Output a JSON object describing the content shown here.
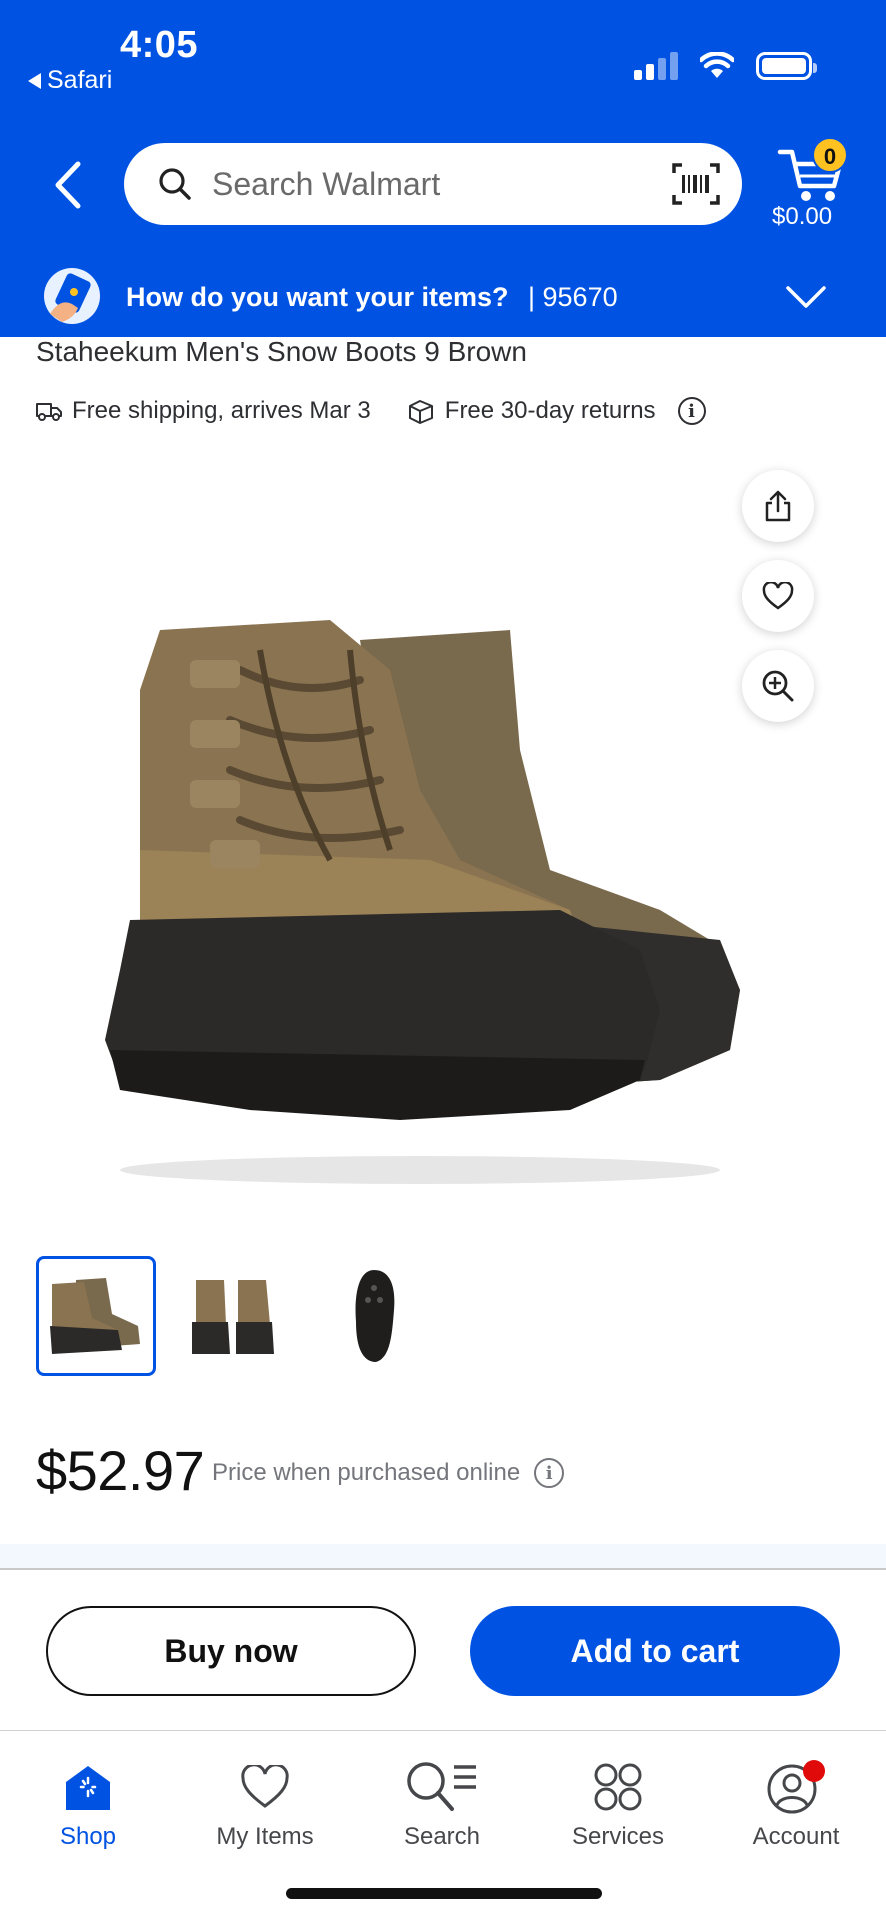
{
  "status_bar": {
    "time": "4:05",
    "back_app": "Safari"
  },
  "header": {
    "search_placeholder": "Search Walmart",
    "cart_count": "0",
    "cart_total": "$0.00",
    "delivery_question": "How do you want your items?",
    "delivery_zip": "| 95670",
    "brand_color": "#0053e2"
  },
  "product": {
    "title": "Staheekum Men's Snow Boots 9 Brown",
    "shipping": "Free shipping, arrives Mar 3",
    "returns": "Free 30-day returns",
    "price": "$52.97",
    "price_note": "Price when purchased online",
    "thumbnails": [
      "boot-pair-side",
      "boot-pair-front",
      "boot-sole"
    ],
    "actions": [
      "share-icon",
      "heart-icon",
      "zoom-in-icon"
    ]
  },
  "buttons": {
    "buy_now": "Buy now",
    "add_to_cart": "Add to cart"
  },
  "tabbar": {
    "items": [
      {
        "label": "Shop",
        "icon": "shop-icon",
        "active": true
      },
      {
        "label": "My Items",
        "icon": "heart-icon"
      },
      {
        "label": "Search",
        "icon": "search-list-icon"
      },
      {
        "label": "Services",
        "icon": "grid-circles-icon"
      },
      {
        "label": "Account",
        "icon": "account-icon"
      }
    ]
  }
}
